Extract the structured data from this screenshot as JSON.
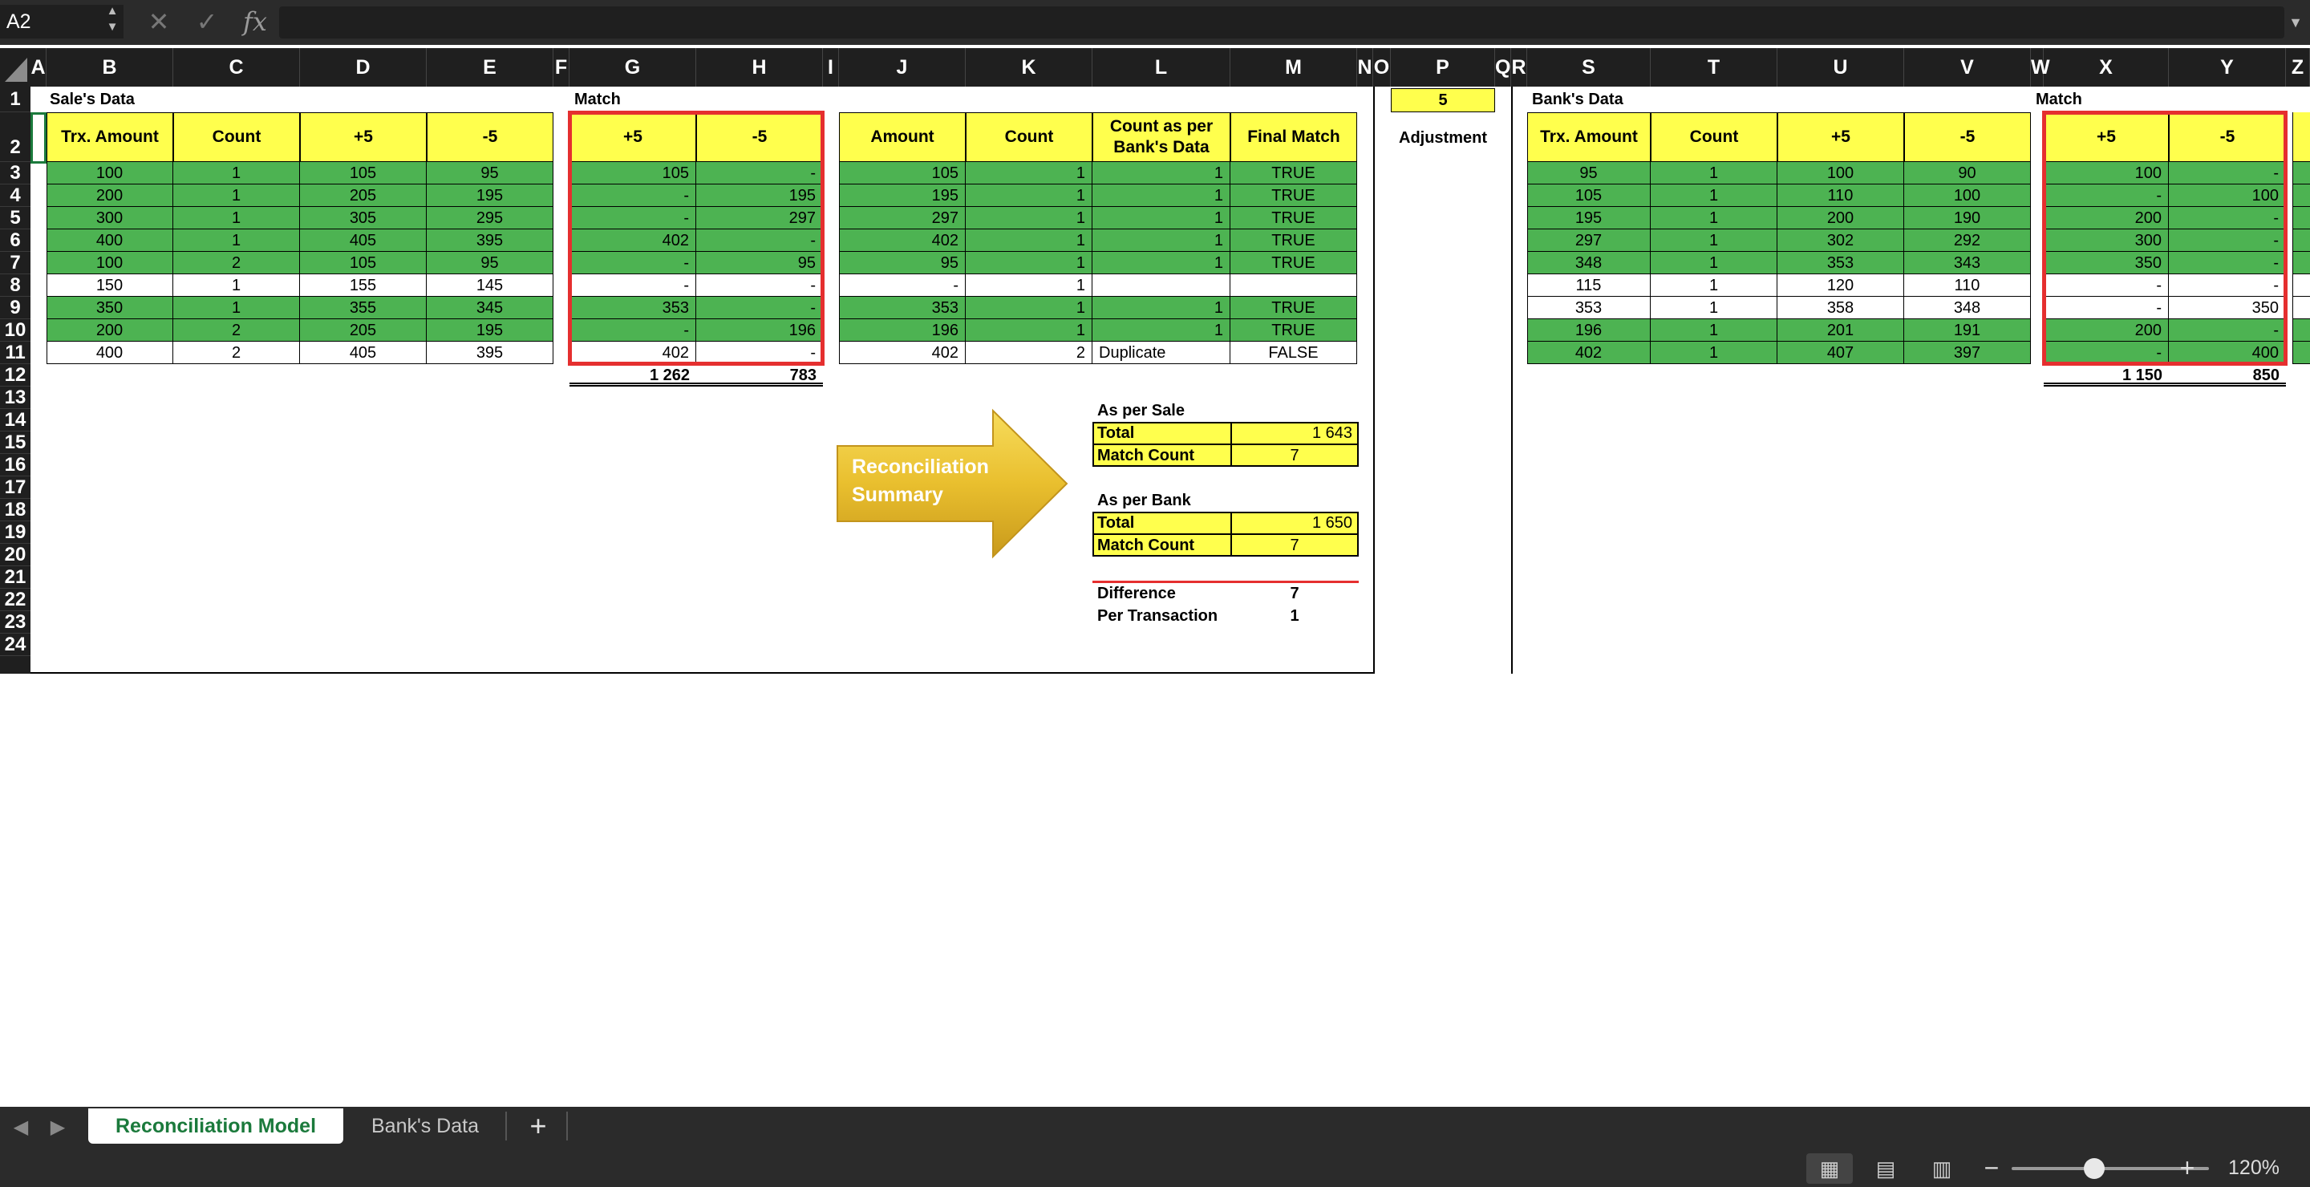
{
  "formula_bar": {
    "name_box": "A2",
    "cancel_icon": "✕",
    "confirm_icon": "✓",
    "fx_label": "fx",
    "formula": ""
  },
  "columns": [
    "A",
    "B",
    "C",
    "D",
    "E",
    "F",
    "G",
    "H",
    "I",
    "J",
    "K",
    "L",
    "M",
    "N",
    "O",
    "P",
    "Q",
    "R",
    "S",
    "T",
    "U",
    "V",
    "W",
    "X",
    "Y",
    "Z"
  ],
  "rows": [
    "1",
    "2",
    "3",
    "4",
    "5",
    "6",
    "7",
    "8",
    "9",
    "10",
    "11",
    "12",
    "13",
    "14",
    "15",
    "16",
    "17",
    "18",
    "19",
    "20",
    "21",
    "22",
    "23",
    "24"
  ],
  "sales": {
    "title": "Sale's Data",
    "headers": [
      "Trx. Amount",
      "Count",
      "+5",
      "-5"
    ],
    "rows": [
      [
        "100",
        "1",
        "105",
        "95"
      ],
      [
        "200",
        "1",
        "205",
        "195"
      ],
      [
        "300",
        "1",
        "305",
        "295"
      ],
      [
        "400",
        "1",
        "405",
        "395"
      ],
      [
        "100",
        "2",
        "105",
        "95"
      ],
      [
        "150",
        "1",
        "155",
        "145"
      ],
      [
        "350",
        "1",
        "355",
        "345"
      ],
      [
        "200",
        "2",
        "205",
        "195"
      ],
      [
        "400",
        "2",
        "405",
        "395"
      ]
    ],
    "row_fill": [
      "green",
      "green",
      "green",
      "green",
      "green",
      "white",
      "green",
      "green",
      "white"
    ]
  },
  "sales_match": {
    "title": "Match",
    "headers": [
      "+5",
      "-5"
    ],
    "rows": [
      [
        "105",
        "-"
      ],
      [
        "-",
        "195"
      ],
      [
        "-",
        "297"
      ],
      [
        "402",
        "-"
      ],
      [
        "-",
        "95"
      ],
      [
        "-",
        "-"
      ],
      [
        "353",
        "-"
      ],
      [
        "-",
        "196"
      ],
      [
        "402",
        "-"
      ]
    ],
    "row_fill": [
      "green",
      "green",
      "green",
      "green",
      "green",
      "white",
      "green",
      "green",
      "white"
    ],
    "totals": [
      "1 262",
      "783"
    ]
  },
  "result": {
    "headers": [
      "Amount",
      "Count",
      "Count as per Bank's Data",
      "Final Match"
    ],
    "rows": [
      [
        "105",
        "1",
        "1",
        "TRUE"
      ],
      [
        "195",
        "1",
        "1",
        "TRUE"
      ],
      [
        "297",
        "1",
        "1",
        "TRUE"
      ],
      [
        "402",
        "1",
        "1",
        "TRUE"
      ],
      [
        "95",
        "1",
        "1",
        "TRUE"
      ],
      [
        "-",
        "1",
        "",
        ""
      ],
      [
        "353",
        "1",
        "1",
        "TRUE"
      ],
      [
        "196",
        "1",
        "1",
        "TRUE"
      ],
      [
        "402",
        "2",
        "Duplicate",
        "FALSE"
      ]
    ],
    "row_fill": [
      "green",
      "green",
      "green",
      "green",
      "green",
      "white",
      "green",
      "green",
      "white"
    ]
  },
  "adjustment": {
    "value": "5",
    "label": "Adjustment"
  },
  "bank": {
    "title": "Bank's Data",
    "headers": [
      "Trx. Amount",
      "Count",
      "+5",
      "-5"
    ],
    "rows": [
      [
        "95",
        "1",
        "100",
        "90"
      ],
      [
        "105",
        "1",
        "110",
        "100"
      ],
      [
        "195",
        "1",
        "200",
        "190"
      ],
      [
        "297",
        "1",
        "302",
        "292"
      ],
      [
        "348",
        "1",
        "353",
        "343"
      ],
      [
        "115",
        "1",
        "120",
        "110"
      ],
      [
        "353",
        "1",
        "358",
        "348"
      ],
      [
        "196",
        "1",
        "201",
        "191"
      ],
      [
        "402",
        "1",
        "407",
        "397"
      ]
    ],
    "row_fill": [
      "green",
      "green",
      "green",
      "green",
      "green",
      "white",
      "white",
      "green",
      "green"
    ]
  },
  "bank_match": {
    "title": "Match",
    "headers": [
      "+5",
      "-5"
    ],
    "rows": [
      [
        "100",
        "-"
      ],
      [
        "-",
        "100"
      ],
      [
        "200",
        "-"
      ],
      [
        "300",
        "-"
      ],
      [
        "350",
        "-"
      ],
      [
        "-",
        "-"
      ],
      [
        "-",
        "350"
      ],
      [
        "200",
        "-"
      ],
      [
        "-",
        "400"
      ]
    ],
    "row_fill": [
      "green",
      "green",
      "green",
      "green",
      "green",
      "white",
      "white",
      "green",
      "green"
    ],
    "totals": [
      "1 150",
      "850"
    ]
  },
  "summary": {
    "arrow_label_line1": "Reconciliation",
    "arrow_label_line2": "Summary",
    "sale_title": "As per Sale",
    "sale_total_label": "Total",
    "sale_total": "1 643",
    "sale_match_label": "Match Count",
    "sale_match": "7",
    "bank_title": "As per Bank",
    "bank_total_label": "Total",
    "bank_total": "1 650",
    "bank_match_label": "Match Count",
    "bank_match": "7",
    "difference_label": "Difference",
    "difference": "7",
    "per_tx_label": "Per Transaction",
    "per_tx": "1"
  },
  "tabs": {
    "active": "Reconciliation Model",
    "other": "Bank's Data",
    "add": "+"
  },
  "status": {
    "zoom": "120%"
  },
  "colors": {
    "green_fill": "#4db352",
    "yellow_fill": "#ffff4d",
    "red_frame": "#e52f2f",
    "tab_active_text": "#1b7a3c"
  }
}
